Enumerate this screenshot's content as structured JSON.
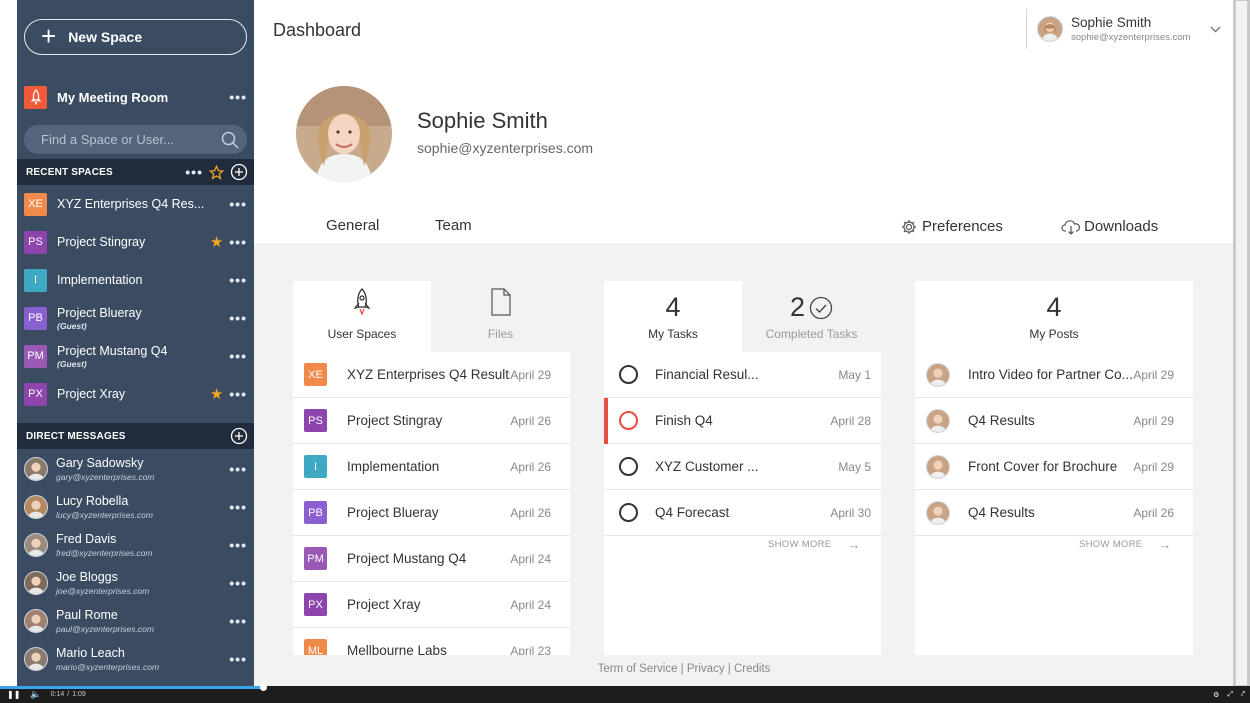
{
  "sidebar": {
    "new_space_label": "New Space",
    "meeting_room": {
      "label": "My Meeting Room"
    },
    "search_placeholder": "Find a Space or User...",
    "recent_header": "RECENT SPACES",
    "recent": [
      {
        "abbr": "XE",
        "name": "XYZ Enterprises Q4 Res...",
        "color": "#f08a4b",
        "guest": "",
        "starred": false
      },
      {
        "abbr": "PS",
        "name": "Project Stingray",
        "color": "#8e44ad",
        "guest": "",
        "starred": true
      },
      {
        "abbr": "I",
        "name": "Implementation",
        "color": "#3fa9c4",
        "guest": "",
        "starred": false
      },
      {
        "abbr": "PB",
        "name": "Project Blueray",
        "color": "#8a5fd0",
        "guest": "(Guest)",
        "starred": false
      },
      {
        "abbr": "PM",
        "name": "Project Mustang Q4",
        "color": "#9b59b6",
        "guest": "(Guest)",
        "starred": false
      },
      {
        "abbr": "PX",
        "name": "Project Xray",
        "color": "#8e44ad",
        "guest": "",
        "starred": true
      }
    ],
    "dm_header": "DIRECT MESSAGES",
    "dms": [
      {
        "name": "Gary Sadowsky",
        "email": "gary@xyzenterprises.com"
      },
      {
        "name": "Lucy Robella",
        "email": "lucy@xyzenterprises.com"
      },
      {
        "name": "Fred Davis",
        "email": "fred@xyzenterprises.com"
      },
      {
        "name": "Joe Bloggs",
        "email": "joe@xyzenterprises.com"
      },
      {
        "name": "Paul Rome",
        "email": "paul@xyzenterprises.com"
      },
      {
        "name": "Mario Leach",
        "email": "mario@xyzenterprises.com"
      }
    ]
  },
  "header": {
    "title": "Dashboard",
    "user_name": "Sophie Smith",
    "user_email": "sophie@xyzenterprises.com"
  },
  "profile": {
    "name": "Sophie Smith",
    "email": "sophie@xyzenterprises.com"
  },
  "tabs": {
    "general": "General",
    "team": "Team",
    "preferences": "Preferences",
    "downloads": "Downloads"
  },
  "spaces_card": {
    "tab1": "User Spaces",
    "tab2": "Files",
    "rows": [
      {
        "abbr": "XE",
        "name": "XYZ Enterprises Q4 Results",
        "date": "April 29",
        "color": "#f08a4b"
      },
      {
        "abbr": "PS",
        "name": "Project Stingray",
        "date": "April 26",
        "color": "#8e44ad"
      },
      {
        "abbr": "I",
        "name": "Implementation",
        "date": "April 26",
        "color": "#3fa9c4"
      },
      {
        "abbr": "PB",
        "name": "Project Blueray",
        "date": "April 26",
        "color": "#8a5fd0"
      },
      {
        "abbr": "PM",
        "name": "Project Mustang Q4",
        "date": "April 24",
        "color": "#9b59b6"
      },
      {
        "abbr": "PX",
        "name": "Project Xray",
        "date": "April 24",
        "color": "#8e44ad"
      },
      {
        "abbr": "ML",
        "name": "Mellbourne Labs",
        "date": "April 23",
        "color": "#f08a4b"
      }
    ]
  },
  "tasks_card": {
    "my_tasks_count": "4",
    "my_tasks_label": "My Tasks",
    "completed_count": "2",
    "completed_label": "Completed Tasks",
    "rows": [
      {
        "name": "Financial Resul...",
        "date": "May 1",
        "overdue": false
      },
      {
        "name": "Finish Q4",
        "date": "April 28",
        "overdue": true
      },
      {
        "name": "XYZ Customer ...",
        "date": "May 5",
        "overdue": false
      },
      {
        "name": "Q4 Forecast",
        "date": "April 30",
        "overdue": false
      }
    ],
    "show_more": "SHOW MORE"
  },
  "posts_card": {
    "count": "4",
    "label": "My Posts",
    "rows": [
      {
        "name": "Intro Video for Partner Co...",
        "date": "April 29"
      },
      {
        "name": "Q4 Results",
        "date": "April 29"
      },
      {
        "name": "Front Cover for Brochure",
        "date": "April 29"
      },
      {
        "name": "Q4 Results",
        "date": "April 26"
      }
    ],
    "show_more": "SHOW MORE"
  },
  "footer": {
    "terms": "Term of Service",
    "privacy": "Privacy",
    "credits": "Credits"
  },
  "player": {
    "elapsed": "0:14",
    "total": "1:09",
    "progress": 0.21
  },
  "colors": {
    "sidebar_bg": "#3a4b62",
    "section_bg": "#202c3c",
    "accent": "#1c6fc4",
    "overdue": "#e74c3c",
    "star": "#f5a623"
  }
}
